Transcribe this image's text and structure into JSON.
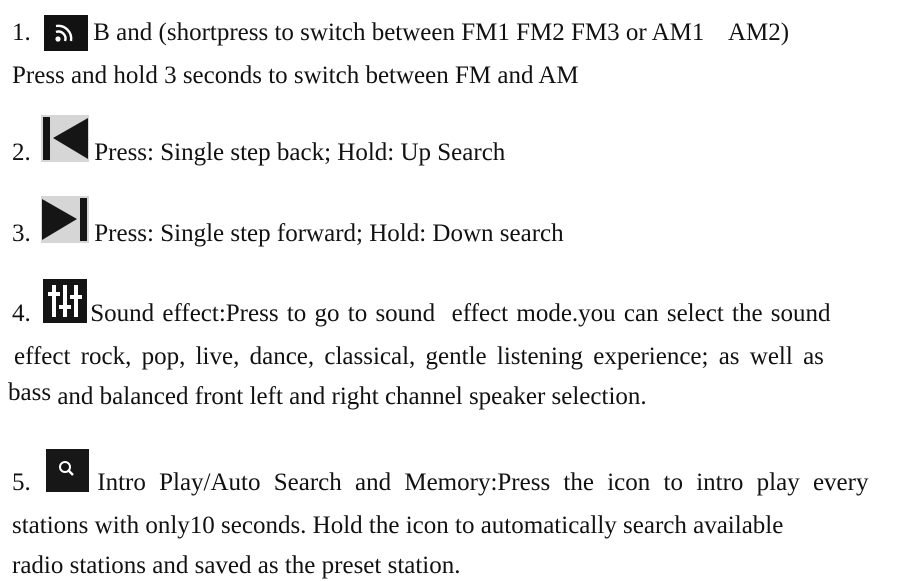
{
  "items": [
    {
      "number": "1.",
      "icon": "rss-icon",
      "text": "B and (shortpress to switch between FM1 FM2 FM3 or AM1    AM2)",
      "line2": "Press and hold 3 seconds to switch between FM and AM"
    },
    {
      "number": "2.",
      "icon": "skip-back-icon",
      "text": "Press: Single step back; Hold: Up Search"
    },
    {
      "number": "3.",
      "icon": "skip-forward-icon",
      "text": "Press: Single step forward; Hold: Down search"
    },
    {
      "number": "4.",
      "icon": "equalizer-icon",
      "text": "Sound effect:Press to go to sound  effect mode.you can select the sound",
      "line2": "effect rock, pop, live, dance, classical, gentle listening experience; as well as",
      "line3_prefix": "bass",
      "line3": "and balanced front left and right channel speaker selection."
    },
    {
      "number": "5.",
      "icon": "search-icon",
      "text": "Intro Play/Auto Search and Memory:Press the icon to intro play every",
      "line2": "stations with only10 seconds. Hold the icon to automatically search available",
      "line3": "radio stations and saved as the preset station."
    }
  ]
}
